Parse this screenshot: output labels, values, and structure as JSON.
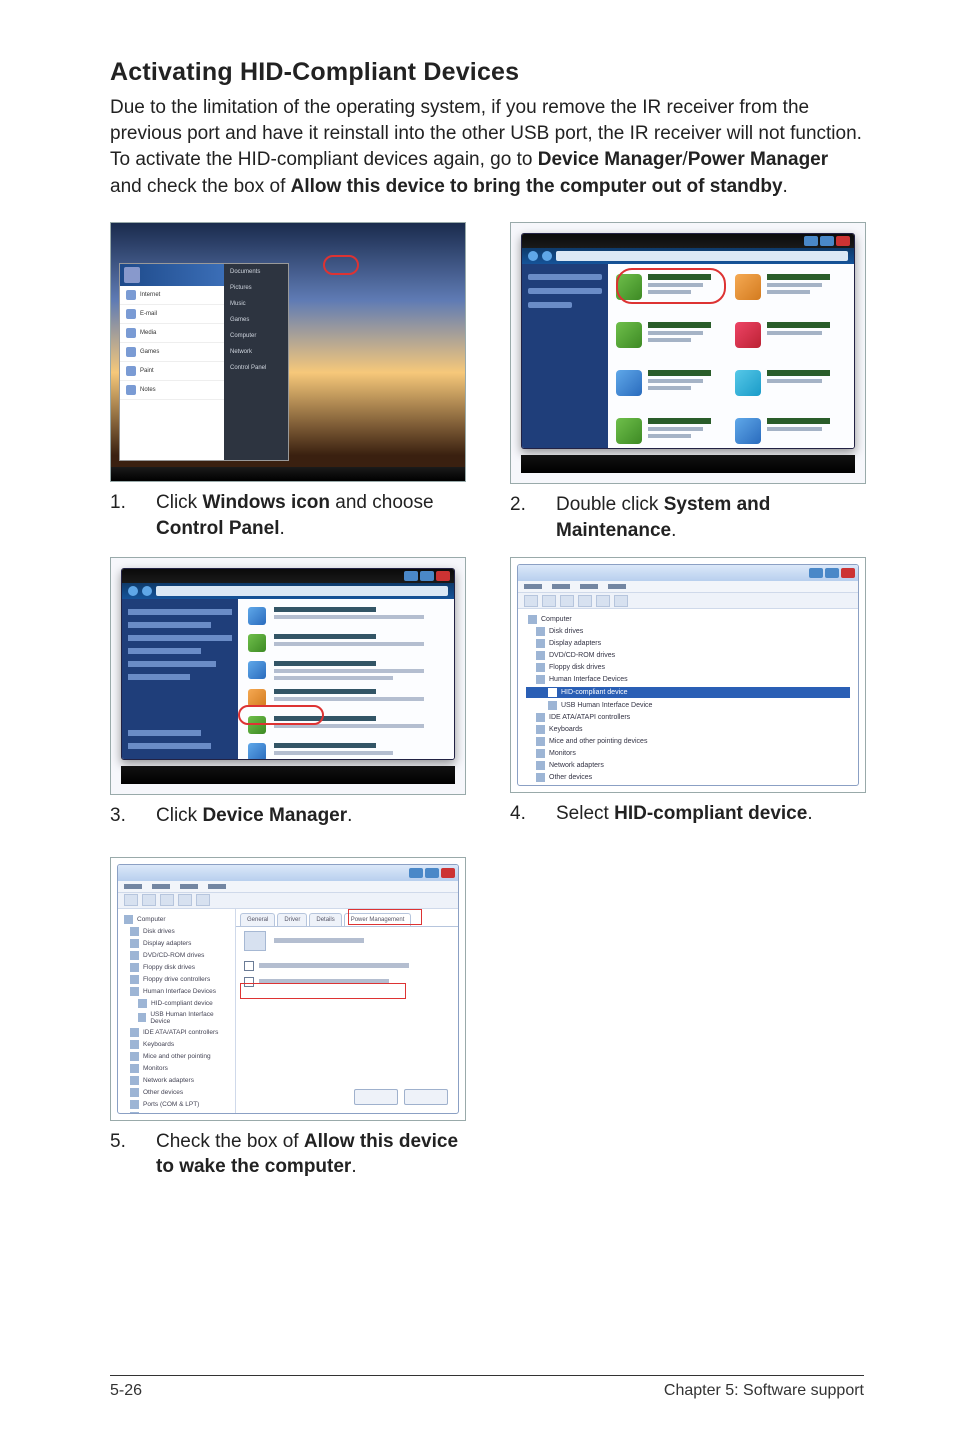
{
  "heading": "Activating HID-Compliant Devices",
  "intro": {
    "part1": "Due to the limitation of the operating system, if you remove the IR receiver from the previous port and have it reinstall into the other USB port, the IR receiver will not function. To activate the HID-compliant devices again, go to ",
    "bold1": "Device Manager",
    "slash": "/",
    "bold2": "Power Manager",
    "part2": " and check the box of ",
    "bold3": "Allow this device to bring the computer out of standby",
    "period": "."
  },
  "steps": {
    "s1": {
      "num": "1.",
      "pre": "Click ",
      "b1": "Windows icon",
      "mid": " and choose ",
      "b2": "Control Panel",
      "post": "."
    },
    "s2": {
      "num": "2.",
      "pre": "Double click ",
      "b1": "System and Maintenance",
      "post": "."
    },
    "s3": {
      "num": "3.",
      "pre": "Click ",
      "b1": "Device Manager",
      "post": "."
    },
    "s4": {
      "num": "4.",
      "pre": "Select ",
      "b1": "HID-compliant device",
      "post": "."
    },
    "s5": {
      "num": "5.",
      "pre": "Check the box of ",
      "b1": "Allow this device to wake the computer",
      "post": "."
    }
  },
  "footer": {
    "left": "5-26",
    "right": "Chapter 5: Software support"
  }
}
